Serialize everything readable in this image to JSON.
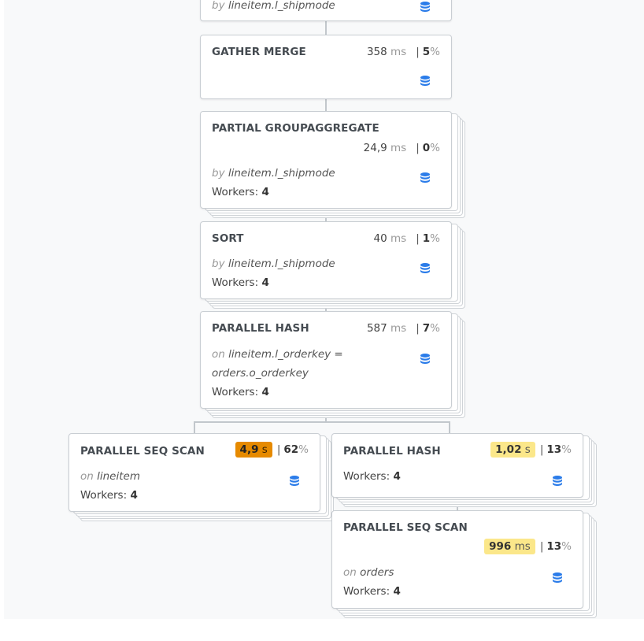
{
  "nodes": {
    "top_partial": {
      "detail_prefix": "by",
      "detail_value": "lineitem.l_shipmode"
    },
    "gather_merge": {
      "title": "GATHER MERGE",
      "duration": "358",
      "duration_unit": "ms",
      "percent": "5",
      "percent_unit": "%"
    },
    "partial_groupaggregate": {
      "title": "PARTIAL GROUPAGGREGATE",
      "duration": "24,9",
      "duration_unit": "ms",
      "percent": "0",
      "percent_unit": "%",
      "detail_prefix": "by",
      "detail_value": "lineitem.l_shipmode",
      "workers_label": "Workers:",
      "workers": "4"
    },
    "sort": {
      "title": "SORT",
      "duration": "40",
      "duration_unit": "ms",
      "percent": "1",
      "percent_unit": "%",
      "detail_prefix": "by",
      "detail_value": "lineitem.l_shipmode",
      "workers_label": "Workers:",
      "workers": "4"
    },
    "parallel_hash_join": {
      "title": "PARALLEL HASH",
      "duration": "587",
      "duration_unit": "ms",
      "percent": "7",
      "percent_unit": "%",
      "detail_prefix": "on",
      "detail_value_line1": "lineitem.l_orderkey =",
      "detail_value_line2": "orders.o_orderkey",
      "workers_label": "Workers:",
      "workers": "4"
    },
    "seq_scan_lineitem": {
      "title": "PARALLEL SEQ SCAN",
      "duration": "4,9",
      "duration_unit": "s",
      "percent": "62",
      "percent_unit": "%",
      "detail_prefix": "on",
      "detail_value": "lineitem",
      "workers_label": "Workers:",
      "workers": "4",
      "highlight": "#e68a00"
    },
    "parallel_hash": {
      "title": "PARALLEL HASH",
      "duration": "1,02",
      "duration_unit": "s",
      "percent": "13",
      "percent_unit": "%",
      "workers_label": "Workers:",
      "workers": "4",
      "highlight": "#fbe78a"
    },
    "seq_scan_orders": {
      "title": "PARALLEL SEQ SCAN",
      "duration": "996",
      "duration_unit": "ms",
      "percent": "13",
      "percent_unit": "%",
      "detail_prefix": "on",
      "detail_value": "orders",
      "workers_label": "Workers:",
      "workers": "4",
      "highlight": "#fbe78a"
    }
  },
  "colors": {
    "db_icon": "#2b7ce9",
    "connector": "#c2c7cc"
  }
}
